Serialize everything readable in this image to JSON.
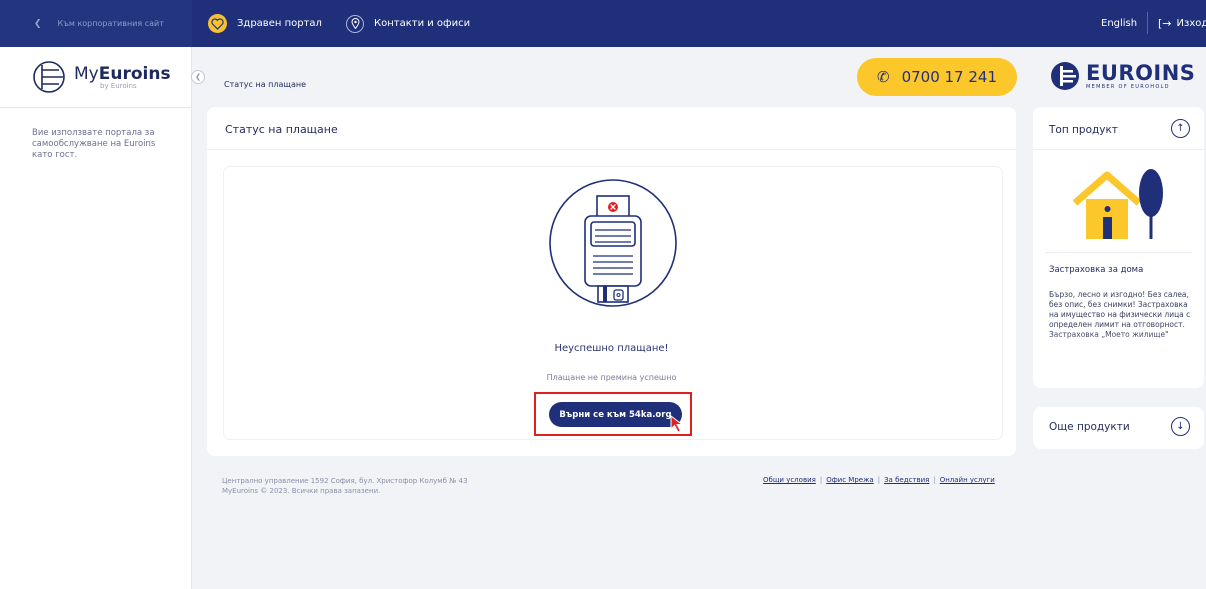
{
  "topbar": {
    "corporate_link": "Към корпоративния сайт",
    "health_portal": "Здравен портал",
    "contacts": "Контакти и офиси",
    "language": "English",
    "exit": "Изход"
  },
  "sidebar": {
    "brand_prefix": "My",
    "brand_name": "Euroins",
    "brand_sub": "by Euroins",
    "info": "Вие използвате портала за самообслужване на Euroins като гост."
  },
  "header": {
    "breadcrumb": "Статус на плащане",
    "phone": "0700 17 241",
    "logo_word": "EUROINS",
    "logo_tagline": "MEMBER OF EUROHOLD"
  },
  "main": {
    "card_title": "Статус на плащане",
    "result_title": "Неуспешно плащане!",
    "result_message": "Плащане не премина успешно",
    "return_button": "Върни се към 54ka.org"
  },
  "footer": {
    "address": "Централно управление 1592 София, бул. Христофор Колумб № 43",
    "copyright": "MyEuroins © 2023. Всички права запазени.",
    "links": [
      "Общи условия",
      "Офис Мрежа",
      "За бедствия",
      "Онлайн услуги"
    ]
  },
  "right_panel": {
    "top_product_title": "Топ продукт",
    "product_name": "Застраховка за дома",
    "product_desc": "Бързо, лесно и изгодно! Без салеа, без опис, без снимки! Застраховка на имущество на физически лица с определен лимит на отговорност. Застраховка „Моето жилище\"",
    "more_products": "Още продукти"
  },
  "colors": {
    "navy": "#1f2f7a",
    "yellow": "#fcc72a",
    "highlight_red": "#e0201f"
  }
}
